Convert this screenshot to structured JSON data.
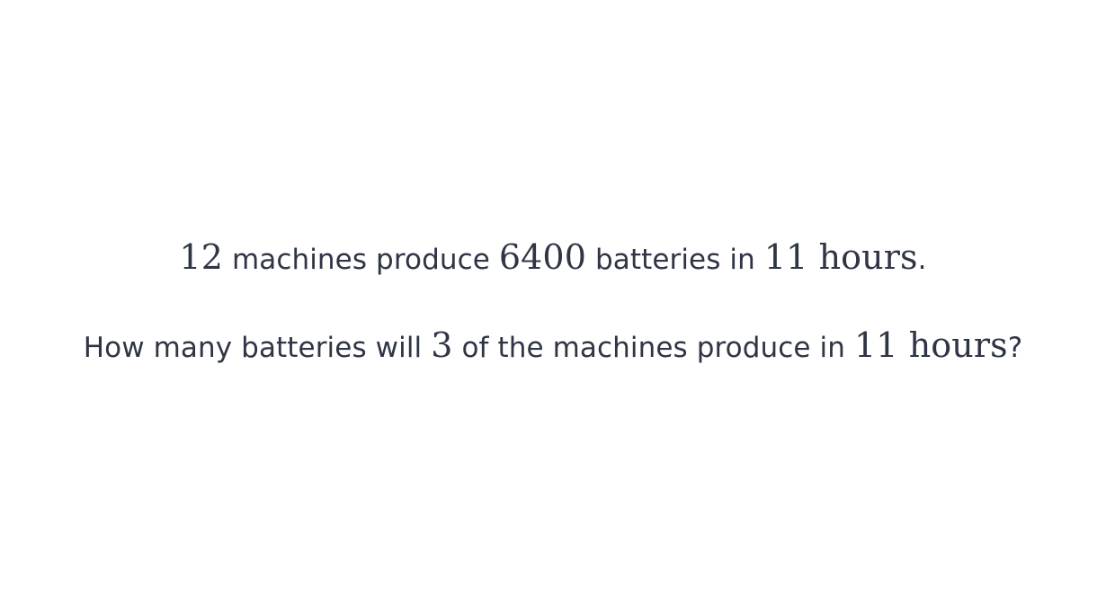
{
  "problem": {
    "line1": {
      "n_machines": "12",
      "t1": " machines produce ",
      "n_batteries": "6400",
      "t2": " batteries in ",
      "n_hours": "11",
      "space": " ",
      "unit": "hours",
      "end": "."
    },
    "line2": {
      "t1": "How many batteries will ",
      "n_machines": "3",
      "t2": " of the machines produce in ",
      "n_hours": "11",
      "space": " ",
      "unit": "hours",
      "end": "?"
    }
  }
}
